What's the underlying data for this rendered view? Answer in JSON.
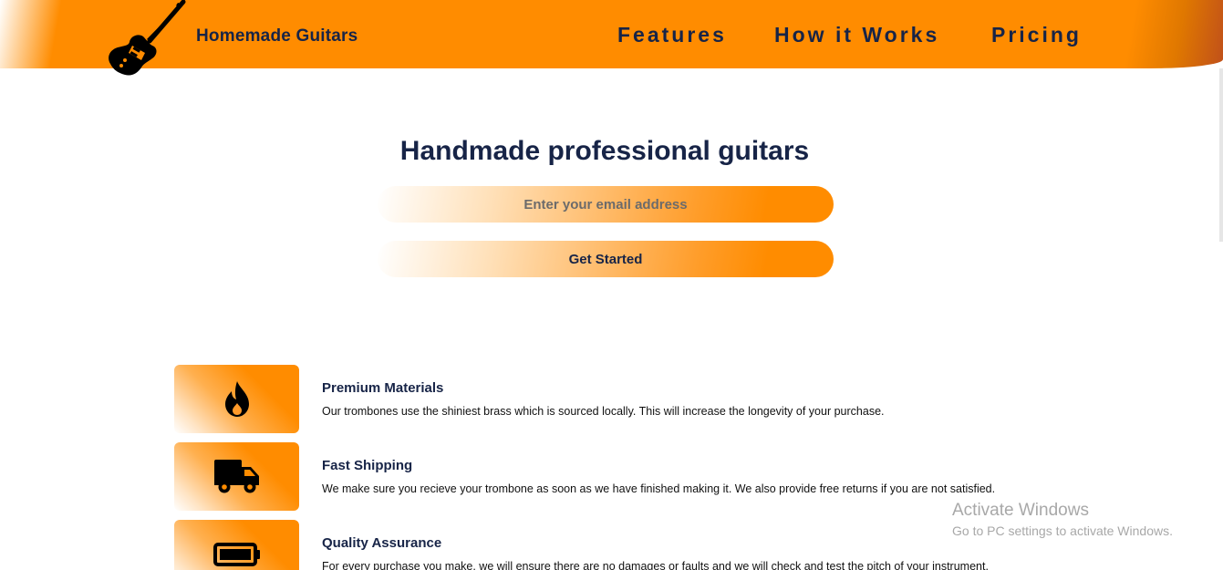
{
  "header": {
    "brand": "Homemade Guitars",
    "nav": {
      "features": "Features",
      "how_it_works": "How it Works",
      "pricing": "Pricing"
    },
    "logo_icon": "electric-guitar-icon",
    "accent_color": "#ff8c00",
    "text_color": "#172447"
  },
  "hero": {
    "title": "Handmade professional guitars",
    "email_placeholder": "Enter your email address",
    "cta_label": "Get Started"
  },
  "features": [
    {
      "icon": "fire-icon",
      "title": "Premium Materials",
      "description": "Our trombones use the shiniest brass which is sourced locally. This will increase the longevity of your purchase."
    },
    {
      "icon": "truck-icon",
      "title": "Fast Shipping",
      "description": "We make sure you recieve your trombone as soon as we have finished making it. We also provide free returns if you are not satisfied."
    },
    {
      "icon": "battery-full-icon",
      "title": "Quality Assurance",
      "description": "For every purchase you make, we will ensure there are no damages or faults and we will check and test the pitch of your instrument."
    }
  ],
  "os_overlay": {
    "title": "Activate Windows",
    "subtitle": "Go to PC settings to activate Windows."
  }
}
